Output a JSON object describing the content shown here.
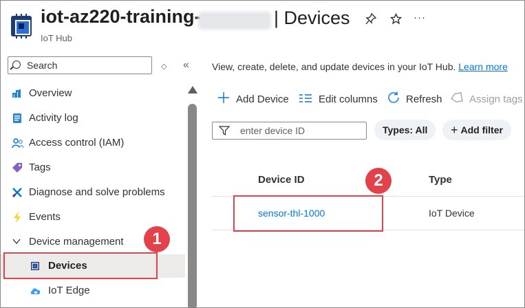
{
  "header": {
    "title": "iot-az220-training-",
    "title_suffix": "| Devices",
    "subtitle": "IoT Hub",
    "icons": [
      "pin-icon",
      "star-icon",
      "more-icon"
    ]
  },
  "sidebar": {
    "search_placeholder": "Search",
    "items": [
      {
        "label": "Overview",
        "icon": "overview-icon"
      },
      {
        "label": "Activity log",
        "icon": "activity-log-icon"
      },
      {
        "label": "Access control (IAM)",
        "icon": "access-control-icon"
      },
      {
        "label": "Tags",
        "icon": "tag-icon"
      },
      {
        "label": "Diagnose and solve problems",
        "icon": "wrench-icon"
      },
      {
        "label": "Events",
        "icon": "lightning-icon"
      },
      {
        "label": "Device management",
        "icon": "chevron-down-icon"
      },
      {
        "label": "Devices",
        "icon": "chip-icon",
        "selected": true
      },
      {
        "label": "IoT Edge",
        "icon": "cloud-icon"
      }
    ]
  },
  "main": {
    "intro_text": "View, create, delete, and update devices in your IoT Hub.",
    "learn_more": "Learn more",
    "toolbar": {
      "add_device": "Add Device",
      "edit_columns": "Edit columns",
      "refresh": "Refresh",
      "assign_tags": "Assign tags"
    },
    "filter": {
      "placeholder": "enter device ID",
      "types_pill": "Types: All",
      "add_filter": "Add filter"
    },
    "table": {
      "columns": [
        "Device ID",
        "Type"
      ],
      "rows": [
        {
          "device_id": "sensor-thl-1000",
          "type": "IoT Device"
        }
      ]
    }
  },
  "annotations": {
    "badge_1": "1",
    "badge_2": "2"
  },
  "colors": {
    "accent": "#0078d4",
    "callout": "#e3424b",
    "selected_bg": "#edebe9"
  }
}
